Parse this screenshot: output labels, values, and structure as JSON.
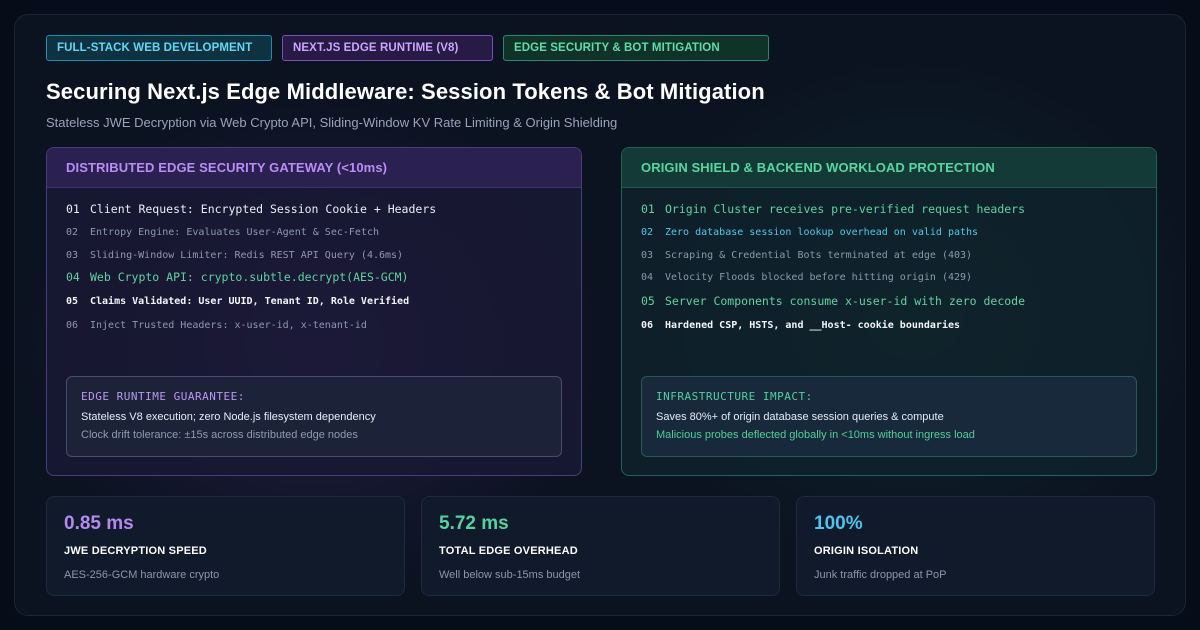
{
  "badges": [
    "FULL-STACK WEB DEVELOPMENT",
    "NEXT.JS EDGE RUNTIME (V8)",
    "EDGE SECURITY & BOT MITIGATION"
  ],
  "title": "Securing Next.js Edge Middleware: Session Tokens & Bot Mitigation",
  "subtitle": "Stateless JWE Decryption via Web Crypto API, Sliding-Window KV Rate Limiting & Origin Shielding",
  "left_panel": {
    "heading": "DISTRIBUTED EDGE SECURITY GATEWAY (<10ms)",
    "steps": [
      {
        "num": "01",
        "text": "Client Request: Encrypted Session Cookie + Headers"
      },
      {
        "num": "02",
        "text": "Entropy Engine: Evaluates User-Agent & Sec-Fetch"
      },
      {
        "num": "03",
        "text": "Sliding-Window Limiter: Redis REST API Query (4.6ms)"
      },
      {
        "num": "04",
        "text": "Web Crypto API: crypto.subtle.decrypt(AES-GCM)"
      },
      {
        "num": "05",
        "text": "Claims Validated: User UUID, Tenant ID, Role Verified"
      },
      {
        "num": "06",
        "text": "Inject Trusted Headers: x-user-id, x-tenant-id"
      }
    ],
    "box": {
      "title": "EDGE RUNTIME GUARANTEE:",
      "line1": "Stateless V8 execution; zero Node.js filesystem dependency",
      "line2": "Clock drift tolerance: ±15s across distributed edge nodes"
    }
  },
  "right_panel": {
    "heading": "ORIGIN SHIELD & BACKEND WORKLOAD PROTECTION",
    "steps": [
      {
        "num": "01",
        "text": "Origin Cluster receives pre-verified request headers"
      },
      {
        "num": "02",
        "text": "Zero database session lookup overhead on valid paths"
      },
      {
        "num": "03",
        "text": "Scraping & Credential Bots terminated at edge (403)"
      },
      {
        "num": "04",
        "text": "Velocity Floods blocked before hitting origin (429)"
      },
      {
        "num": "05",
        "text": "Server Components consume x-user-id with zero decode"
      },
      {
        "num": "06",
        "text": "Hardened CSP, HSTS, and __Host- cookie boundaries"
      }
    ],
    "box": {
      "title": "INFRASTRUCTURE IMPACT:",
      "line1": "Saves 80%+ of origin database session queries & compute",
      "line2": "Malicious probes deflected globally in <10ms without ingress load"
    }
  },
  "metrics": [
    {
      "value": "0.85 ms",
      "label": "JWE DECRYPTION SPEED",
      "desc": "AES-256-GCM hardware crypto",
      "color": "#b48af0"
    },
    {
      "value": "5.72 ms",
      "label": "TOTAL EDGE OVERHEAD",
      "desc": "Well below sub-15ms budget",
      "color": "#54d2a0"
    },
    {
      "value": "100%",
      "label": "ORIGIN ISOLATION",
      "desc": "Junk traffic dropped at PoP",
      "color": "#4cc4ec"
    }
  ]
}
